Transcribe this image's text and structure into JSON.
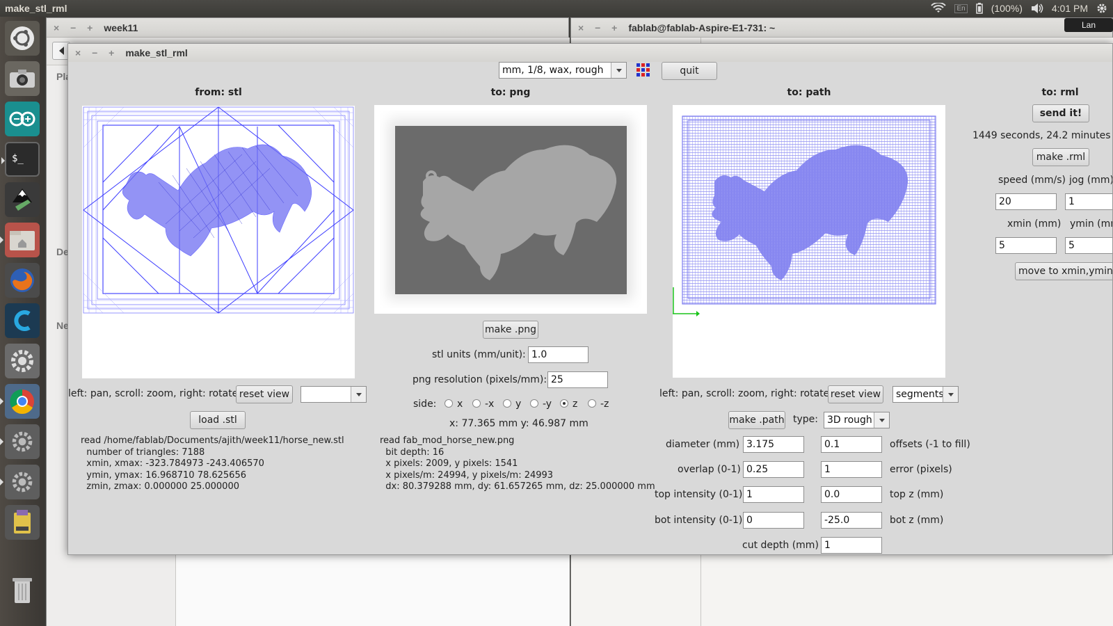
{
  "topbar": {
    "title": "make_stl_rml",
    "keyboard": "En",
    "battery": "(100%)",
    "time": "4:01 PM"
  },
  "launcher": {
    "items": [
      "ubuntu-dash-icon",
      "camera-icon",
      "arduino-icon",
      "terminal-icon",
      "inkscape-icon",
      "files-icon",
      "firefox-icon",
      "c-app-icon",
      "settings-icon",
      "chrome-icon",
      "settings-icon",
      "settings-icon",
      "usb-drive-icon",
      "trash-icon"
    ]
  },
  "bg_windows": {
    "files_title": "week11",
    "files_sidebar": [
      "Pla",
      "De",
      "Ne"
    ],
    "terminal_title": "fablab@fablab-Aspire-E1-731: ~",
    "tooltip": "Lan"
  },
  "window": {
    "title": "make_stl_rml",
    "machine_select": "mm, 1/8, wax, rough",
    "quit_label": "quit"
  },
  "stl": {
    "header": "from: stl",
    "hint": "left: pan, scroll: zoom, right: rotate",
    "reset_label": "reset view",
    "view_select": "",
    "load_label": "load .stl",
    "info": "read /home/fablab/Documents/ajith/week11/horse_new.stl\n  number of triangles: 7188\n  xmin, xmax: -323.784973 -243.406570\n  ymin, ymax: 16.968710 78.625656\n  zmin, zmax: 0.000000 25.000000"
  },
  "png": {
    "header": "to: png",
    "make_label": "make .png",
    "units_label": "stl units (mm/unit):",
    "units_value": "1.0",
    "resolution_label": "png resolution (pixels/mm):",
    "resolution_value": "25",
    "side_label": "side:",
    "sides": [
      "x",
      "-x",
      "y",
      "-y",
      "z",
      "-z"
    ],
    "selected_side": "z",
    "coords": "x: 77.365 mm  y: 46.987 mm",
    "info": "read fab_mod_horse_new.png\n  bit depth: 16\n  x pixels: 2009, y pixels: 1541\n  x pixels/m: 24994, y pixels/m: 24993\n  dx: 80.379288 mm, dy: 61.657265 mm, dz: 25.000000 mm"
  },
  "path": {
    "header": "to: path",
    "hint": "left: pan, scroll: zoom, right: rotate",
    "reset_label": "reset view",
    "view_select": "segments",
    "make_label": "make .path",
    "type_label": "type:",
    "type_value": "3D rough",
    "diameter_label": "diameter (mm)",
    "diameter_value": "3.175",
    "offsets_value": "0.1",
    "offsets_label": "offsets (-1 to fill)",
    "overlap_label": "overlap (0-1)",
    "overlap_value": "0.25",
    "error_value": "1",
    "error_label": "error (pixels)",
    "top_intensity_label": "top intensity (0-1)",
    "top_intensity_value": "1",
    "top_z_value": "0.0",
    "top_z_label": "top z (mm)",
    "bot_intensity_label": "bot intensity (0-1)",
    "bot_intensity_value": "0",
    "bot_z_value": "-25.0",
    "bot_z_label": "bot z (mm)",
    "cut_depth_label": "cut depth (mm)",
    "cut_depth_value": "1"
  },
  "rml": {
    "header": "to: rml",
    "send_label": "send it!",
    "time_info": "1449 seconds, 24.2 minutes",
    "make_label": "make .rml",
    "speed_label": "speed (mm/s)",
    "jog_label": "jog (mm)",
    "speed_value": "20",
    "jog_value": "1",
    "xmin_label": "xmin (mm)",
    "ymin_label": "ymin (mm)",
    "xmin_value": "5",
    "ymin_value": "5",
    "move_label": "move to xmin,ymin"
  },
  "colors": {
    "wire": "#5b5bff",
    "toolpath": "#7b7bf2",
    "png_bg": "#6b6b6b",
    "png_shape": "#a6a6a6",
    "axis_green": "#19c419"
  }
}
